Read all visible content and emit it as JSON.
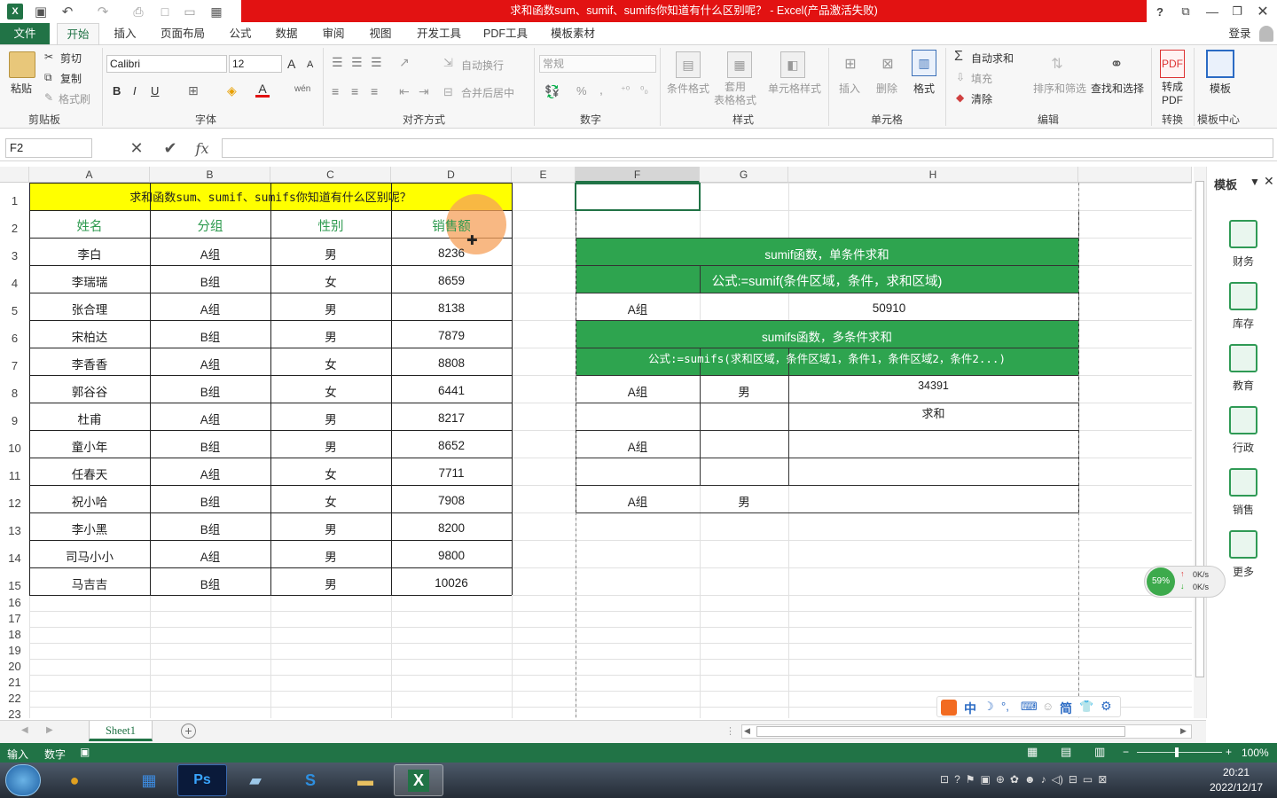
{
  "window": {
    "title": "求和函数sum、sumif、sumifs你知道有什么区别呢？ - Excel(产品激活失败)",
    "help": "?",
    "login": "登录"
  },
  "tabs": [
    "文件",
    "开始",
    "插入",
    "页面布局",
    "公式",
    "数据",
    "审阅",
    "视图",
    "开发工具",
    "PDF工具",
    "模板素材"
  ],
  "ribbon": {
    "clipboard": {
      "paste": "粘贴",
      "cut": "剪切",
      "copy": "复制",
      "format_painter": "格式刷",
      "label": "剪贴板"
    },
    "font": {
      "name": "Calibri",
      "size": "12",
      "bold": "B",
      "italic": "I",
      "underline": "U",
      "grow": "A",
      "shrink": "A",
      "wen": "wén",
      "label": "字体"
    },
    "align": {
      "wrap": "自动换行",
      "merge": "合并后居中",
      "label": "对齐方式"
    },
    "number": {
      "format": "常规",
      "percent": "%",
      "comma": ",",
      "label": "数字"
    },
    "styles": {
      "conditional": "条件格式",
      "table": "套用\n表格格式",
      "cell": "单元格样式",
      "label": "样式"
    },
    "cells": {
      "insert": "插入",
      "delete": "删除",
      "format": "格式",
      "label": "单元格"
    },
    "editing": {
      "autosum": "自动求和",
      "fill": "填充",
      "clear": "清除",
      "sort": "排序和筛选",
      "find": "查找和选择",
      "label": "编辑"
    },
    "convert": {
      "pdf": "转成\nPDF",
      "label": "转换"
    },
    "template": {
      "btn": "模板",
      "label": "模板中心"
    }
  },
  "formula_bar": {
    "name_box": "F2",
    "value": ""
  },
  "columns": [
    "A",
    "B",
    "C",
    "D",
    "E",
    "F",
    "G",
    "H"
  ],
  "rows": [
    "1",
    "2",
    "3",
    "4",
    "5",
    "6",
    "7",
    "8",
    "9",
    "10",
    "11",
    "12",
    "13",
    "14",
    "15",
    "16",
    "17",
    "18",
    "19",
    "20",
    "21",
    "22",
    "23"
  ],
  "sheet_title": "求和函数sum、sumif、sumifs你知道有什么区别呢？",
  "table_header": [
    "姓名",
    "分组",
    "性别",
    "销售额"
  ],
  "table_rows": [
    [
      "李白",
      "A组",
      "男",
      "8236"
    ],
    [
      "李瑞瑞",
      "B组",
      "女",
      "8659"
    ],
    [
      "张合理",
      "A组",
      "男",
      "8138"
    ],
    [
      "宋柏达",
      "B组",
      "男",
      "7879"
    ],
    [
      "李香香",
      "A组",
      "女",
      "8808"
    ],
    [
      "郭谷谷",
      "B组",
      "女",
      "6441"
    ],
    [
      "杜甫",
      "A组",
      "男",
      "8217"
    ],
    [
      "童小年",
      "B组",
      "男",
      "8652"
    ],
    [
      "任春天",
      "A组",
      "女",
      "7711"
    ],
    [
      "祝小哈",
      "B组",
      "女",
      "7908"
    ],
    [
      "李小黑",
      "B组",
      "男",
      "8200"
    ],
    [
      "司马小小",
      "A组",
      "男",
      "9800"
    ],
    [
      "马吉吉",
      "B组",
      "男",
      "10026"
    ]
  ],
  "right": {
    "sumif_title": "sumif函数，单条件求和",
    "sumif_formula": "公式:=sumif(条件区域，条件，求和区域)",
    "sumif_cond": "A组",
    "sumif_result": "50910",
    "sumifs_title": "sumifs函数，多条件求和",
    "sumifs_formula": "公式:=sumifs(求和区域，条件区域1，条件1，条件区域2，条件2...)",
    "sumifs_cond1": "A组",
    "sumifs_cond2": "男",
    "sumifs_result": "34391",
    "sum_label": "求和",
    "r10_cond": "A组",
    "r12_cond1": "A组",
    "r12_cond2": "男"
  },
  "template_panel": {
    "title": "模板",
    "items": [
      "财务",
      "库存",
      "教育",
      "行政",
      "销售",
      "更多"
    ]
  },
  "net_widget": {
    "percent": "59%",
    "up": "0K/s",
    "down": "0K/s"
  },
  "ime_bar": [
    "中",
    "简"
  ],
  "sheet_tab": "Sheet1",
  "status": {
    "mode": "输入",
    "num": "数字",
    "zoom": "100%"
  },
  "clock": {
    "time": "20:21",
    "date": "2022/12/17"
  },
  "colors": {
    "excel_green": "#217346",
    "header_yellow": "#ffff00",
    "header_text": "#2e9a4f",
    "band_green": "#2ea44f",
    "title_red": "#e21212"
  }
}
